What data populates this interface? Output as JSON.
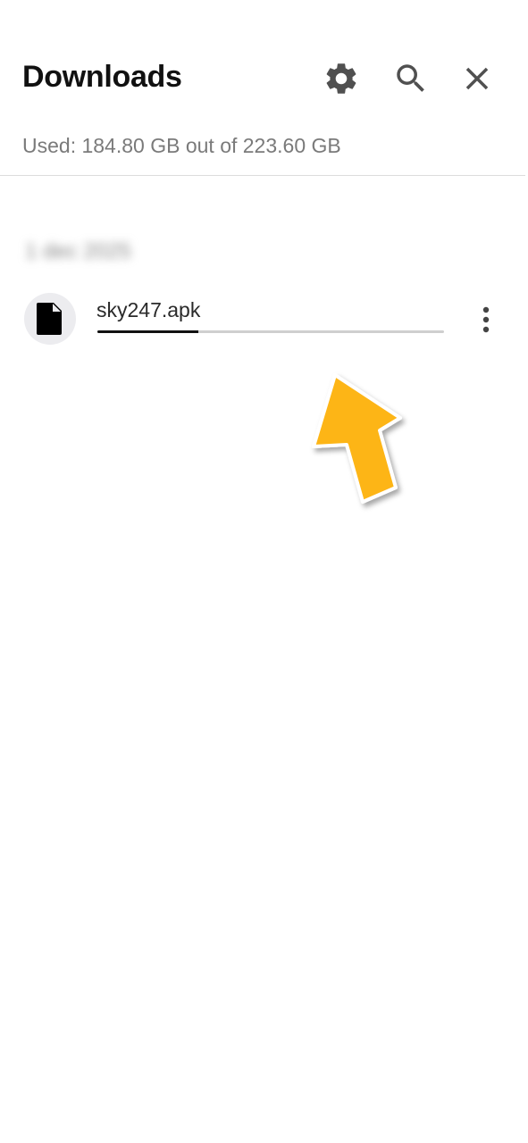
{
  "header": {
    "title": "Downloads",
    "settings_icon": "gear-icon",
    "search_icon": "search-icon",
    "close_icon": "close-icon"
  },
  "storage": {
    "text": "Used: 184.80 GB out of 223.60 GB"
  },
  "downloads": {
    "date_group": "1 dec 2025",
    "items": [
      {
        "file_name": "sky247.apk",
        "icon": "file-icon",
        "progress": 0.29,
        "menu_icon": "more-vert-icon"
      }
    ]
  },
  "overlay": {
    "arrow_color": "#FDB515"
  }
}
